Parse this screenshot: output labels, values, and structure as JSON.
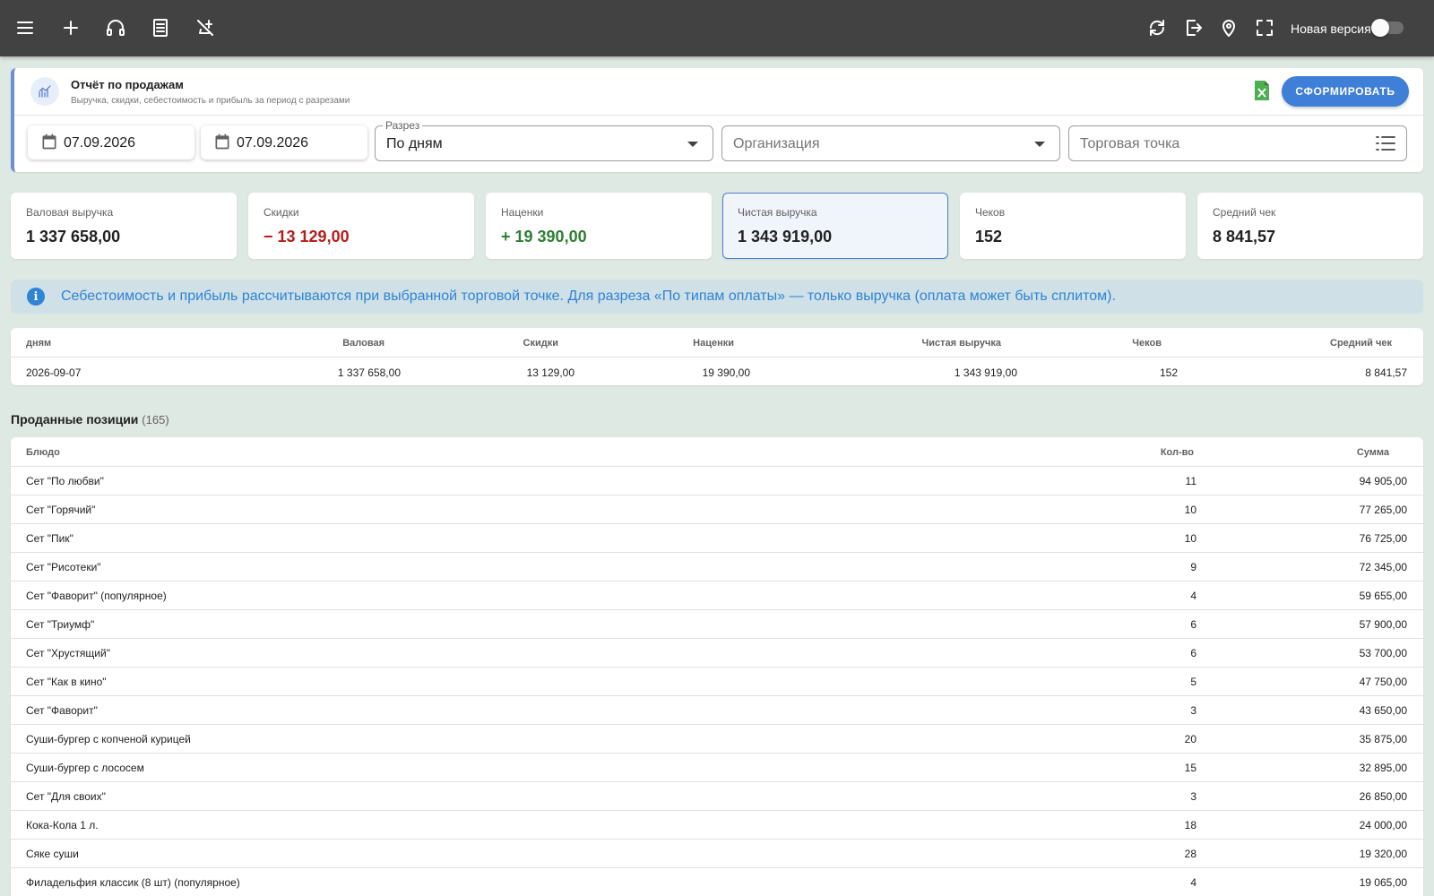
{
  "topbar": {
    "icons": [
      "menu-icon",
      "plus-icon",
      "headset-icon",
      "receipt-icon",
      "no-food-icon",
      "sync-icon",
      "logout-icon",
      "map-pin-icon",
      "fullscreen-icon"
    ],
    "new_version_label": "Новая версия",
    "new_version_enabled": false
  },
  "report": {
    "title": "Отчёт по продажам",
    "subtitle": "Выручка, скидки, себестоимость и прибыль за период с разрезами",
    "generate_label": "СФОРМИРОВАТЬ",
    "date_from": "07.09.2026",
    "date_to": "07.09.2026",
    "slice_label": "Разрез",
    "slice_value": "По дням",
    "organization_placeholder": "Организация",
    "point_placeholder": "Торговая точка"
  },
  "metrics": [
    {
      "label": "Валовая выручка",
      "value": "1 337 658,00"
    },
    {
      "label": "Скидки",
      "value": "− 13 129,00"
    },
    {
      "label": "Наценки",
      "value": "+ 19 390,00"
    },
    {
      "label": "Чистая выручка",
      "value": "1 343 919,00"
    },
    {
      "label": "Чеков",
      "value": "152"
    },
    {
      "label": "Средний чек",
      "value": "8 841,57"
    }
  ],
  "alert": {
    "text": "Себестоимость и прибыль рассчитываются при выбранной торговой точке. Для разреза «По типам оплаты» — только выручка (оплата может быть сплитом)."
  },
  "summary": {
    "headers": [
      "дням",
      "Валовая",
      "Скидки",
      "Наценки",
      "Чистая выручка",
      "Чеков",
      "Средний чек"
    ],
    "row": [
      "2026-09-07",
      "1 337 658,00",
      "13 129,00",
      "19 390,00",
      "1 343 919,00",
      "152",
      "8 841,57"
    ]
  },
  "positions": {
    "title": "Проданные позиции",
    "count": "(165)",
    "headers": [
      "Блюдо",
      "Кол-во",
      "Сумма"
    ],
    "rows": [
      [
        "Сет \"По любви\"",
        "11",
        "94 905,00"
      ],
      [
        "Сет \"Горячий\"",
        "10",
        "77 265,00"
      ],
      [
        "Сет \"Пик\"",
        "10",
        "76 725,00"
      ],
      [
        "Сет \"Рисотеки\"",
        "9",
        "72 345,00"
      ],
      [
        "Сет \"Фаворит\" (популярное)",
        "4",
        "59 655,00"
      ],
      [
        "Сет \"Триумф\"",
        "6",
        "57 900,00"
      ],
      [
        "Сет \"Хрустящий\"",
        "6",
        "53 700,00"
      ],
      [
        "Сет \"Как в кино\"",
        "5",
        "47 750,00"
      ],
      [
        "Сет \"Фаворит\"",
        "3",
        "43 650,00"
      ],
      [
        "Суши-бургер с копченой курицей",
        "20",
        "35 875,00"
      ],
      [
        "Суши-бургер с лососем",
        "15",
        "32 895,00"
      ],
      [
        "Сет \"Для своих\"",
        "3",
        "26 850,00"
      ],
      [
        "Кока-Кола 1 л.",
        "18",
        "24 000,00"
      ],
      [
        "Сяке суши",
        "28",
        "19 320,00"
      ],
      [
        "Филадельфия классик (8 шт) (популярное)",
        "4",
        "19 065,00"
      ]
    ]
  },
  "colors": {
    "accent": "#3f7fd8",
    "negative": "#b71c1c",
    "positive": "#2e7d32",
    "info": "#2f84d6"
  }
}
